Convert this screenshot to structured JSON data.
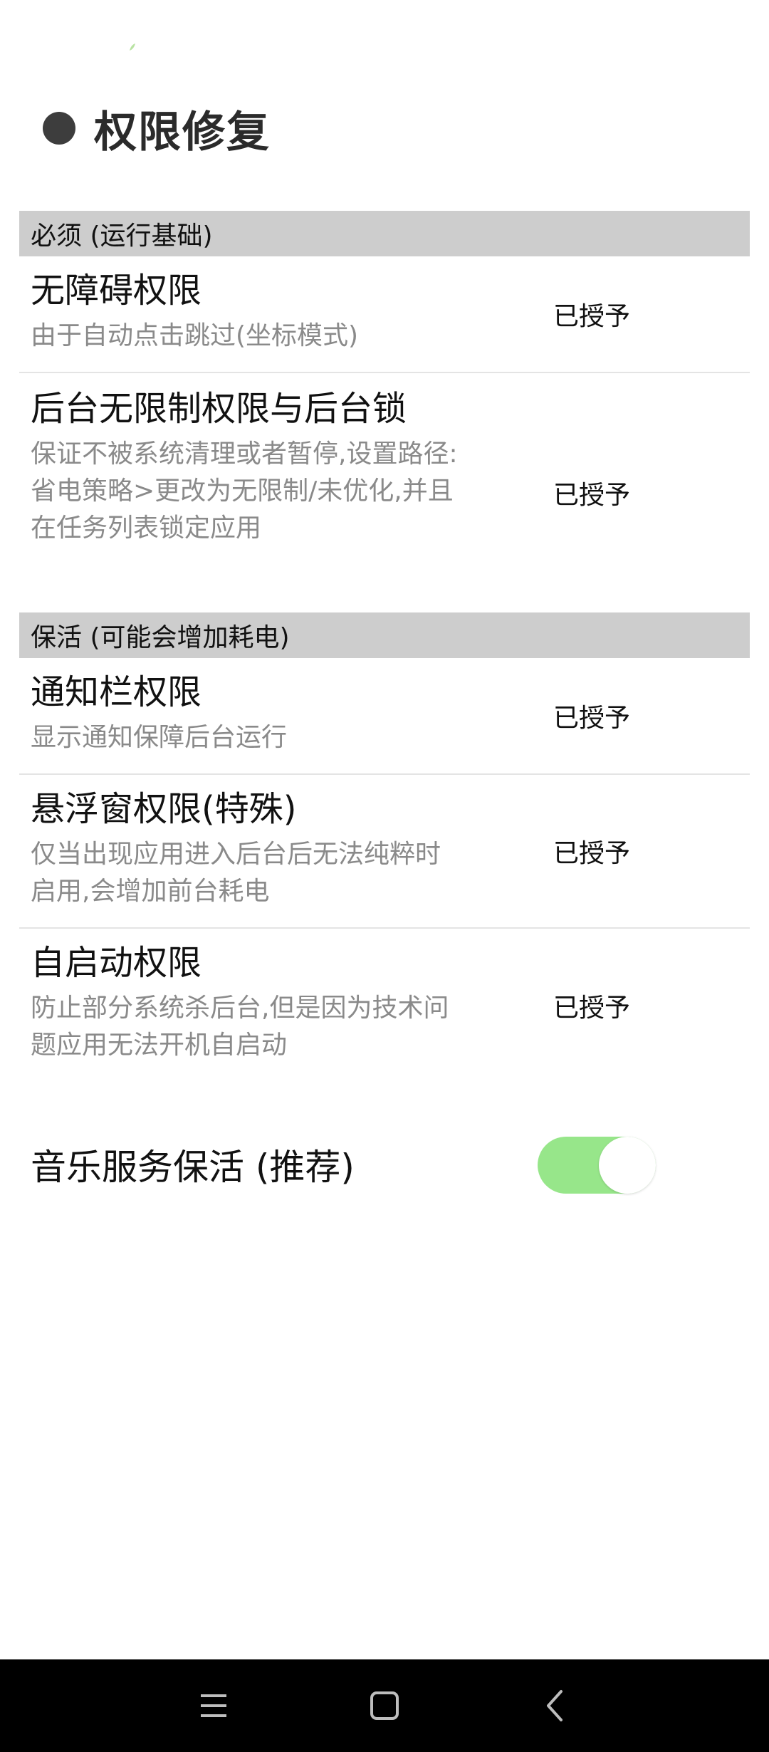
{
  "header": {
    "title": "权限修复"
  },
  "sections": [
    {
      "title": "必须 (运行基础)",
      "items": [
        {
          "title": "无障碍权限",
          "desc": "由于自动点击跳过(坐标模式)",
          "status": "已授予"
        },
        {
          "title": "后台无限制权限与后台锁",
          "desc": "保证不被系统清理或者暂停,设置路径: 省电策略>更改为无限制/未优化,并且在任务列表锁定应用",
          "status": "已授予"
        }
      ]
    },
    {
      "title": "保活 (可能会增加耗电)",
      "items": [
        {
          "title": "通知栏权限",
          "desc": "显示通知保障后台运行",
          "status": "已授予"
        },
        {
          "title": "悬浮窗权限(特殊)",
          "desc": "仅当出现应用进入后台后无法纯粹时启用,会增加前台耗电",
          "status": "已授予"
        },
        {
          "title": "自启动权限",
          "desc": "防止部分系统杀后台,但是因为技术问题应用无法开机自启动",
          "status": "已授予"
        }
      ]
    }
  ],
  "music_keepalive": {
    "label": "音乐服务保活 (推荐)",
    "enabled": true
  },
  "colors": {
    "section_bg": "#cdcdcd",
    "toggle_on": "#97e68a",
    "desc_text": "#8a8a8a",
    "nav_bar": "#000000"
  },
  "nav": {
    "icons": [
      "menu-icon",
      "home-icon",
      "back-icon"
    ]
  }
}
